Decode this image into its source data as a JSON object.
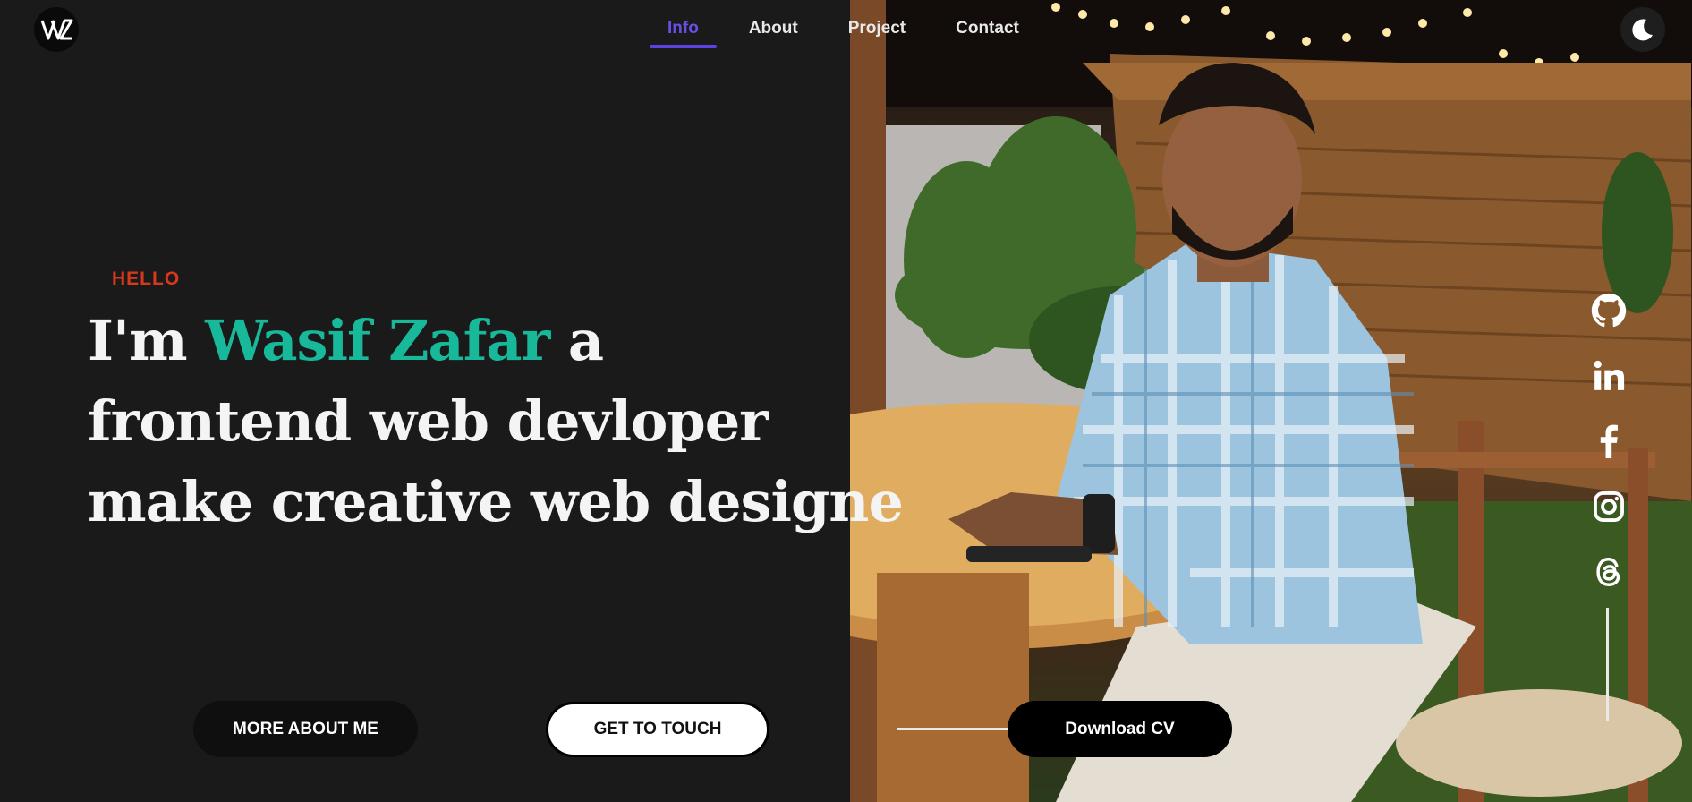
{
  "nav": {
    "items": [
      {
        "label": "Info",
        "active": true
      },
      {
        "label": "About",
        "active": false
      },
      {
        "label": "Project",
        "active": false
      },
      {
        "label": "Contact",
        "active": false
      }
    ]
  },
  "hero": {
    "greeting": "HELLO",
    "line1_prefix": "I'm ",
    "name": "Wasif Zafar",
    "line1_suffix": " a",
    "line2": "frontend web devloper",
    "line3": "make creative web designe"
  },
  "buttons": {
    "more_about": "MORE ABOUT ME",
    "get_to_touch": "GET TO TOUCH",
    "download_cv": "Download CV"
  },
  "socials": [
    "github-icon",
    "linkedin-icon",
    "facebook-icon",
    "instagram-icon",
    "threads-icon"
  ],
  "colors": {
    "background": "#1a1a1a",
    "accent_name": "#18b99a",
    "greeting": "#d6381c",
    "nav_active": "#6a4ee6"
  }
}
